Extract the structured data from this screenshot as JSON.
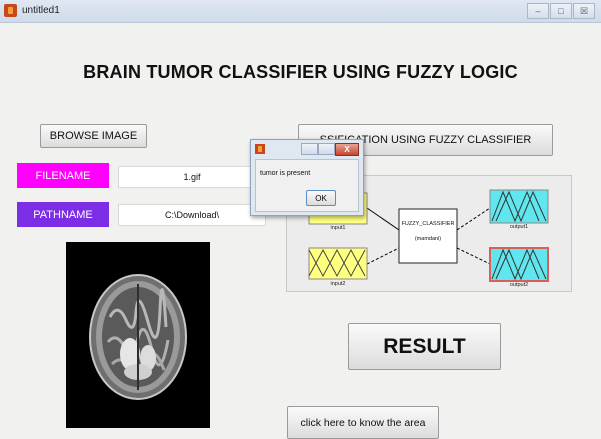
{
  "window": {
    "title": "untitled1",
    "controls": {
      "minimize": "–",
      "maximize": "□",
      "close": "☒"
    }
  },
  "header": {
    "title": "BRAIN TUMOR CLASSIFIER USING FUZZY LOGIC"
  },
  "buttons": {
    "browse": "BROWSE IMAGE",
    "classify": "SSIFICATION USING FUZZY CLASSIFIER",
    "result": "RESULT",
    "area": "click here to know the area"
  },
  "fields": {
    "filename": {
      "label": "FILENAME",
      "value": "1.gif"
    },
    "pathname": {
      "label": "PATHNAME",
      "value": "C:\\Download\\"
    }
  },
  "fis": {
    "system_name": "FUZZY_CLASSIFIER",
    "method": "(mamdani)",
    "inputs": [
      "input1",
      "input2"
    ],
    "outputs": [
      "output1",
      "output2"
    ]
  },
  "dialog": {
    "close_label": "X",
    "message": "tumor is present",
    "ok_label": "OK"
  },
  "colors": {
    "filename_label": "#ff00ff",
    "pathname_label": "#7b2ee6",
    "input_mf": "#ffff80",
    "output_mf": "#5fe6ee",
    "output2_border": "#d9605a"
  },
  "icons": {
    "app": "matlab-icon",
    "brain": "brain-mri-image"
  }
}
